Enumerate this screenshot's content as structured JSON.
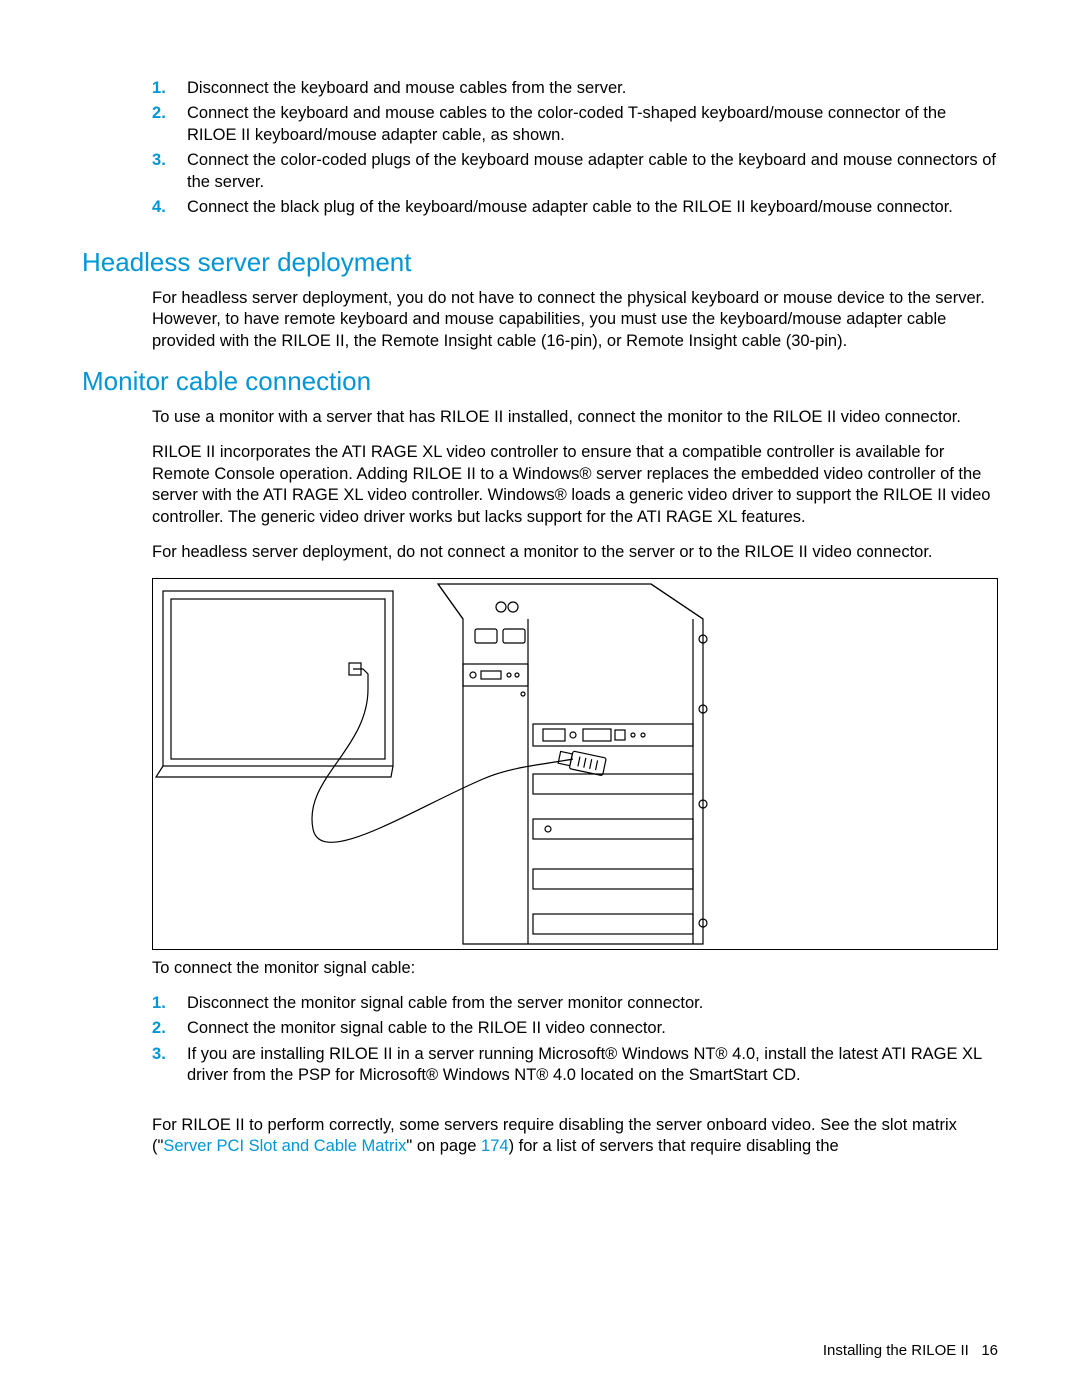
{
  "steps_top": [
    "Disconnect the keyboard and mouse cables from the server.",
    "Connect the keyboard and mouse cables to the color-coded T-shaped keyboard/mouse connector of the RILOE II keyboard/mouse adapter cable, as shown.",
    "Connect the color-coded plugs of the keyboard mouse adapter cable to the keyboard and mouse connectors of the server.",
    "Connect the black plug of the keyboard/mouse adapter cable to the RILOE II keyboard/mouse connector."
  ],
  "headless": {
    "heading": "Headless server deployment",
    "body": "For headless server deployment, you do not have to connect the physical keyboard or mouse device to the server. However, to have remote keyboard and mouse capabilities, you must use the keyboard/mouse adapter cable provided with the RILOE II, the Remote Insight cable (16-pin), or Remote Insight cable (30-pin)."
  },
  "monitor": {
    "heading": "Monitor cable connection",
    "p1": "To use a monitor with a server that has RILOE II installed, connect the monitor to the RILOE II video connector.",
    "p2": "RILOE II incorporates the ATI RAGE XL video controller to ensure that a compatible controller is available for Remote Console operation. Adding RILOE II to a Windows® server replaces the embedded video controller of the server with the ATI RAGE XL video controller. Windows® loads a generic video driver to support the RILOE II video controller. The generic video driver works but lacks support for the ATI RAGE XL features.",
    "p3": "For headless server deployment, do not connect a monitor to the server or to the RILOE II video connector.",
    "p4": "To connect the monitor signal cable:",
    "steps": [
      "Disconnect the monitor signal cable from the server monitor connector.",
      "Connect the monitor signal cable to the RILOE II video connector.",
      "If you are installing RILOE II in a server running Microsoft® Windows NT® 4.0, install the latest ATI RAGE XL driver from the PSP for Microsoft® Windows NT® 4.0 located on the SmartStart CD."
    ],
    "p5_pre": "For RILOE II to perform correctly, some servers require disabling the server onboard video. See the slot matrix (\"",
    "p5_link": "Server PCI Slot and Cable Matrix",
    "p5_mid": "\" on page ",
    "p5_page": "174",
    "p5_post": ") for a list of servers that require disabling the"
  },
  "footer": {
    "text": "Installing the RILOE II",
    "page": "16"
  }
}
